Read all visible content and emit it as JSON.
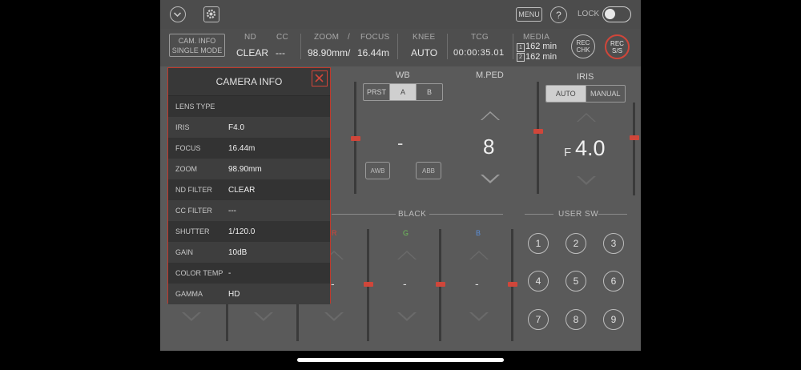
{
  "topbar": {
    "menu": "MENU",
    "help": "?",
    "lock": "LOCK"
  },
  "status": {
    "mode_line1": "CAM. INFO",
    "mode_line2": "SINGLE MODE",
    "nd_label": "ND",
    "nd_value": "CLEAR",
    "cc_label": "CC",
    "cc_value": "---",
    "zoom_label": "ZOOM",
    "zoom_value": "98.90mm",
    "slash": "/",
    "focus_label": "FOCUS",
    "focus_value": "16.44m",
    "knee_label": "KNEE",
    "knee_value": "AUTO",
    "tcg_label": "TCG",
    "tcg_value": "00:00:35.01",
    "media_label": "MEDIA",
    "media1_slot": "1",
    "media1_value": "162 min",
    "media2_slot": "2",
    "media2_value": "162 min",
    "rec_chk_line1": "REC",
    "rec_chk_line2": "CHK",
    "rec_ss_line1": "REC",
    "rec_ss_line2": "S/S"
  },
  "wb": {
    "title": "WB",
    "options": [
      "PRST",
      "A",
      "B"
    ],
    "selected": "A",
    "value": "-",
    "awb": "AWB",
    "abb": "ABB"
  },
  "mped": {
    "title": "M.PED",
    "value": "8"
  },
  "iris": {
    "title": "IRIS",
    "options": [
      "AUTO",
      "MANUAL"
    ],
    "selected": "AUTO",
    "f_prefix": "F",
    "value": "4.0"
  },
  "black": {
    "title": "BLACK",
    "channels": [
      {
        "label": "G",
        "value": "-"
      },
      {
        "label": "B",
        "value": "-"
      },
      {
        "value": "-"
      }
    ]
  },
  "usersw": {
    "title": "USER SW",
    "buttons": [
      "1",
      "2",
      "3",
      "4",
      "5",
      "6",
      "7",
      "8",
      "9"
    ]
  },
  "camera_info": {
    "title": "CAMERA INFO",
    "rows": [
      {
        "key": "LENS TYPE",
        "value": ""
      },
      {
        "key": "IRIS",
        "value": "F4.0"
      },
      {
        "key": "FOCUS",
        "value": "16.44m"
      },
      {
        "key": "ZOOM",
        "value": "98.90mm"
      },
      {
        "key": "ND FILTER",
        "value": "CLEAR"
      },
      {
        "key": "CC FILTER",
        "value": "---"
      },
      {
        "key": "SHUTTER",
        "value": "1/120.0"
      },
      {
        "key": "GAIN",
        "value": "10dB"
      },
      {
        "key": "COLOR TEMP",
        "value": "-"
      },
      {
        "key": "GAMMA",
        "value": "HD"
      }
    ]
  },
  "colors": {
    "accent_red": "#d0463a",
    "green": "#6fbf5a",
    "blue": "#5a8fd8"
  }
}
